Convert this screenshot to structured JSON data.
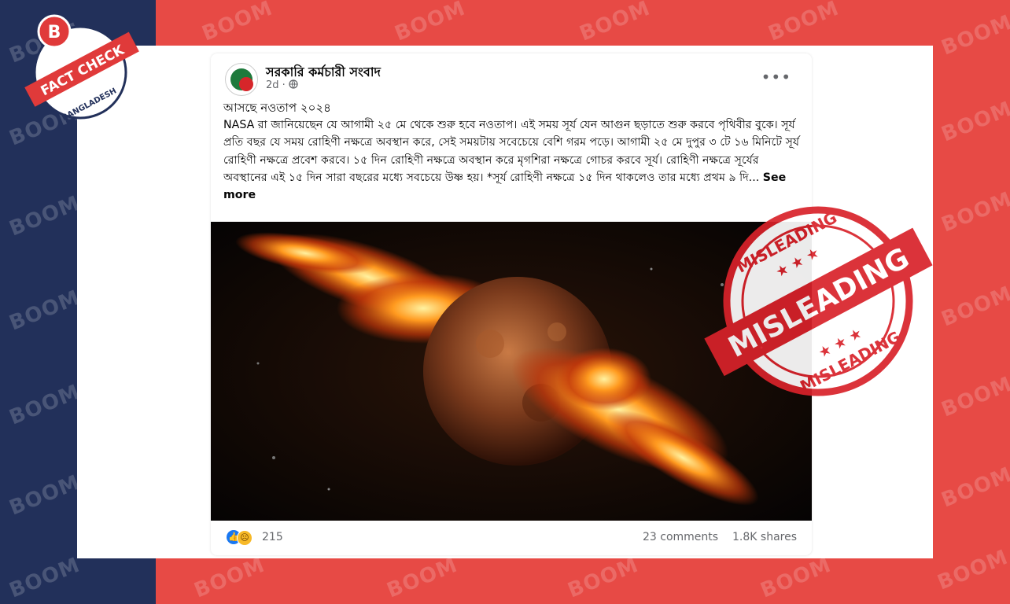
{
  "watermark": "BOOM",
  "badge": {
    "letter": "B",
    "title": "FACT CHECK",
    "country": "BANGLADESH"
  },
  "stamp": {
    "label": "MISLEADING",
    "color": "#d9222a"
  },
  "post": {
    "author": "সরকারি কর্মচারী সংবাদ",
    "time": "2d ·",
    "privacy_icon": "globe-icon",
    "more_label": "•••",
    "heading": "আসছে নওতাপ ২০২৪",
    "body": "NASA রা জানিয়েছেন যে আগামী ২৫ মে থেকে শুরু হবে নওতাপ। এই সময় সূর্য যেন আগুন ছড়াতে শুরু করবে পৃথিবীর বুকে। সূর্য প্রতি বছর যে সময় রোহিণী নক্ষত্রে অবস্থান করে, সেই সময়টায় সবেচেয়ে বেশি গরম পড়ে। আগামী ২৫ মে দুপুর ৩ টে ১৬ মিনিটে সূর্য রোহিণী নক্ষত্রে প্রবেশ করবে। ১৫ দিন রোহিণী নক্ষত্রে অবস্থান করে মৃগশিরা নক্ষত্রে গোচর করবে সূর্য। রোহিণী নক্ষত্রে সূর্যের অবস্থানের এই ১৫ দিন সারা বছরের মধ্যে সবচেয়ে উষ্ণ হয়। *সূর্য রোহিণী নক্ষত্রে ১৫ দিন থাকলেও তার মধ্যে প্রথম ৯ দি...",
    "see_more": "See more",
    "reaction_count": "215",
    "comments": "23 comments",
    "shares": "1.8K shares"
  },
  "colors": {
    "navy": "#22305a",
    "red": "#e74a45",
    "facebook_blue": "#1877f2"
  }
}
